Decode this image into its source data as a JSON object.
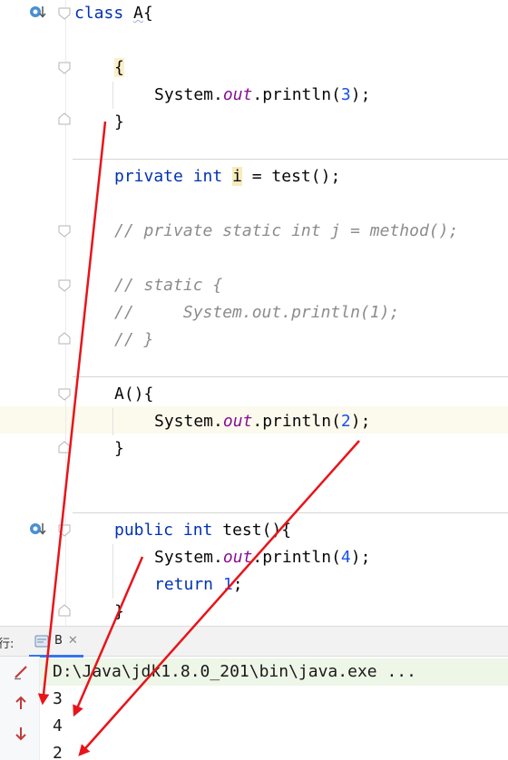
{
  "editor": {
    "lines": {
      "class_kw": "class",
      "class_name": "A",
      "class_open": "{",
      "init_open": "{",
      "init_stmt_prefix": "System.",
      "init_stmt_field": "out",
      "init_stmt_call": ".println(",
      "init_stmt_arg": "3",
      "init_stmt_end": ");",
      "init_close": "}",
      "field_kw1": "private",
      "field_kw2": "int",
      "field_var": "i",
      "field_rest": " = test();",
      "comment_static_field": "// private static int j = method();",
      "comment_static_open": "// static {",
      "comment_static_body": "//     System.out.println(1);",
      "comment_static_close": "// }",
      "ctor_decl": "A(){",
      "ctor_stmt_prefix": "System.",
      "ctor_stmt_field": "out",
      "ctor_stmt_call": ".println(",
      "ctor_stmt_arg": "2",
      "ctor_stmt_end": ");",
      "ctor_close": "}",
      "method_kw1": "public",
      "method_kw2": "int",
      "method_rest": " test(){",
      "method_stmt_prefix": "System.",
      "method_stmt_field": "out",
      "method_stmt_call": ".println(",
      "method_stmt_arg": "4",
      "method_stmt_end": ");",
      "return_kw": "return",
      "return_val": "1",
      "return_end": ";",
      "method_close": "}"
    }
  },
  "console": {
    "run_label": "行:",
    "tab_name": "B",
    "tab_close": "✕",
    "command": "D:\\Java\\jdk1.8.0_201\\bin\\java.exe ...",
    "output": [
      "3",
      "4",
      "2"
    ],
    "toolbar_icons": [
      "edit-pencil-icon",
      "scroll-up-arrow-icon",
      "scroll-down-arrow-icon"
    ]
  },
  "colors": {
    "keyword": "#0033b3",
    "number": "#1750eb",
    "field": "#871094",
    "comment": "#8c8c8c",
    "annotation_arrow": "#e8141a",
    "command_bg": "#edf6e7"
  }
}
